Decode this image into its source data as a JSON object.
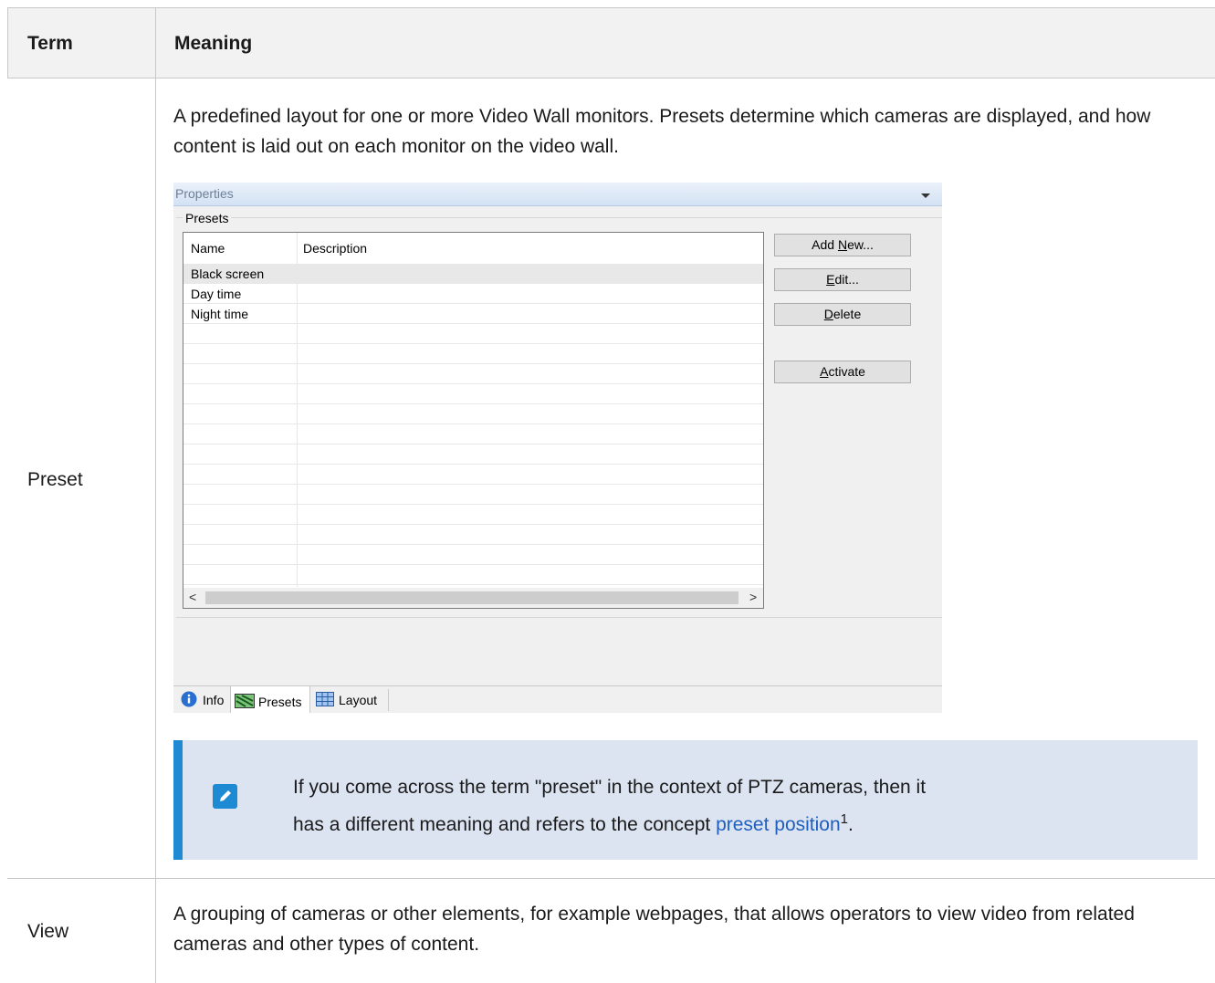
{
  "table": {
    "header_term": "Term",
    "header_meaning": "Meaning"
  },
  "rows": [
    {
      "term": "Preset",
      "meaning": "A predefined layout for one or more Video Wall monitors. Presets determine which cameras are displayed, and how content is laid out on each monitor on the video wall."
    },
    {
      "term": "View",
      "meaning": "A grouping of cameras or other elements, for example webpages, that allows operators to view video from related cameras and other types of content."
    }
  ],
  "screenshot": {
    "title": "Properties",
    "group_label": "Presets",
    "columns": [
      "Name",
      "Description"
    ],
    "items": [
      "Black screen",
      "Day time",
      "Night time"
    ],
    "selected_index": 0,
    "buttons": {
      "add_new_pre": "Add ",
      "add_new_key": "N",
      "add_new_post": "ew...",
      "edit_key": "E",
      "edit_post": "dit...",
      "delete_key": "D",
      "delete_post": "elete",
      "activate_key": "A",
      "activate_post": "ctivate"
    },
    "tabs": [
      "Info",
      "Presets",
      "Layout"
    ],
    "active_tab": "Presets"
  },
  "note": {
    "text_line1": "If you come across the term \"preset\" in the context of PTZ cameras, then it",
    "text_line2_pre": "has a different meaning and refers to the concept ",
    "link": "preset position",
    "sup": "1",
    "text_end": "."
  }
}
